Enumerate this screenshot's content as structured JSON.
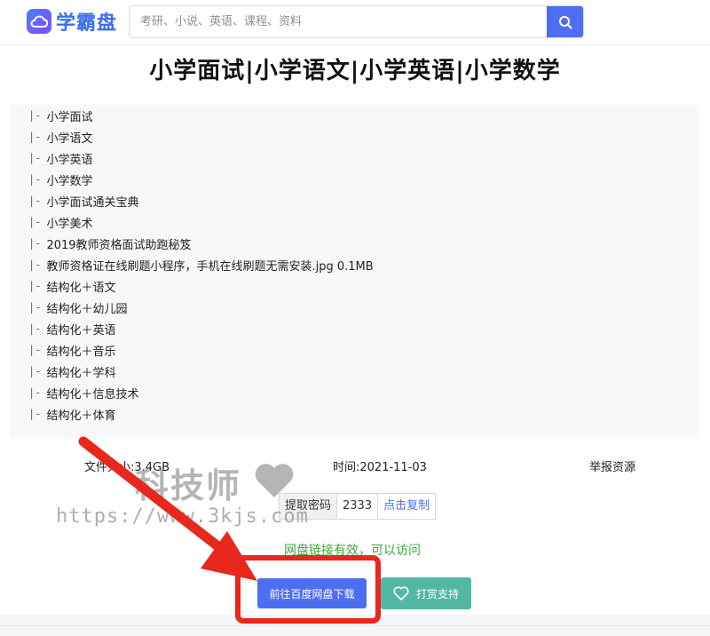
{
  "header": {
    "logo_text": "学霸盘",
    "search_placeholder": "考研、小说、英语、课程、资料"
  },
  "page": {
    "title": "小学面试|小学语文|小学英语|小学数学"
  },
  "files": [
    "小学面试",
    "小学语文",
    "小学英语",
    "小学数学",
    "小学面试通关宝典",
    "小学美术",
    "2019教师资格面试助跑秘笈",
    "教师资格证在线刷题小程序，手机在线刷题无需安装.jpg 0.1MB",
    "结构化＋语文",
    "结构化＋幼儿园",
    "结构化＋英语",
    "结构化＋音乐",
    "结构化＋学科",
    "结构化＋信息技术",
    "结构化＋体育"
  ],
  "tree_prefix": "|-",
  "meta": {
    "size": "文件大小:3.4GB",
    "time": "时间:2021-11-03",
    "report": "举报资源"
  },
  "code": {
    "label": "提取密码",
    "value": "2333",
    "copy": "点击复制"
  },
  "status": "网盘链接有效，可以访问",
  "buttons": {
    "download": "前往百度网盘下载",
    "support": "打赏支持"
  },
  "watermark": {
    "brand": "科技师",
    "url": "https://www.3kjs.com"
  },
  "colors": {
    "primary": "#4e6ef2",
    "success": "#3aa83a",
    "support": "#52b8a4",
    "annotation": "#e8271d"
  },
  "icons": {
    "logo": "cloud-icon",
    "search": "search-icon",
    "support": "heart-icon"
  }
}
